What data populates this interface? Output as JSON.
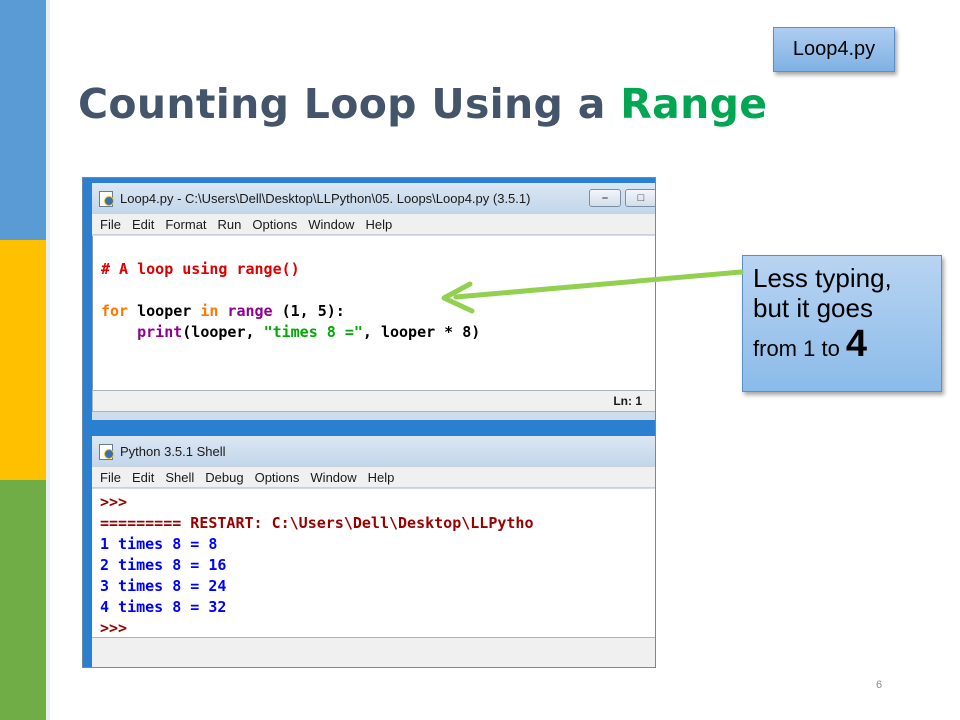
{
  "slide": {
    "title_main": "Counting Loop Using a ",
    "title_accent": "Range",
    "file_tag": "Loop4.py",
    "slide_number": "6",
    "colors": {
      "title": "#44546a",
      "accent": "#00a651",
      "stripe_blue": "#5b9bd5",
      "stripe_yellow": "#ffc000",
      "stripe_green": "#70ad47",
      "arrow": "#92d050"
    }
  },
  "callout": {
    "line1": "Less typing,",
    "line2": "but it goes",
    "line3_prefix": "from 1 to ",
    "line3_emphasis": "4"
  },
  "editor_window": {
    "title": "Loop4.py - C:\\Users\\Dell\\Desktop\\LLPython\\05. Loops\\Loop4.py (3.5.1)",
    "menu": [
      "File",
      "Edit",
      "Format",
      "Run",
      "Options",
      "Window",
      "Help"
    ],
    "code": {
      "comment": "# A loop using range()",
      "kw_for": "for",
      "var": " looper ",
      "kw_in": "in",
      "range_fn": " range",
      "range_args": " (1, 5):",
      "indent": "    ",
      "print_fn": "print",
      "print_open": "(looper, ",
      "print_str": "\"times 8 =\"",
      "print_close": ", looper * 8)"
    },
    "status": "Ln: 1",
    "window_buttons": [
      "minimize-button",
      "maximize-button"
    ]
  },
  "shell_window": {
    "title": "Python 3.5.1 Shell",
    "menu": [
      "File",
      "Edit",
      "Shell",
      "Debug",
      "Options",
      "Window",
      "Help"
    ],
    "prompt": ">>>",
    "restart_line": "========= RESTART: C:\\Users\\Dell\\Desktop\\LLPytho",
    "output": [
      "1 times 8 = 8",
      "2 times 8 = 16",
      "3 times 8 = 24",
      "4 times 8 = 32"
    ],
    "prompt_end": ">>>"
  }
}
